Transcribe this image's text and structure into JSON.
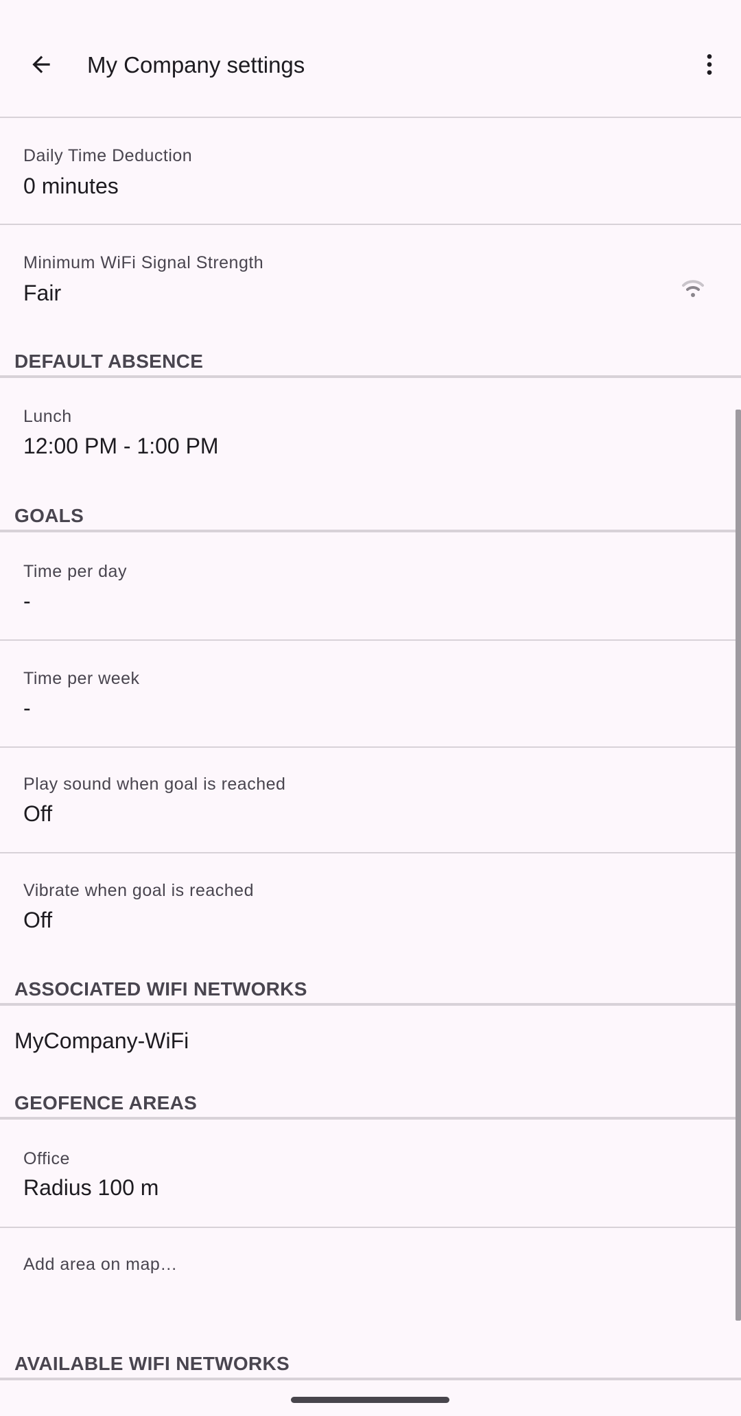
{
  "appbar": {
    "title": "My Company settings",
    "back_icon": "arrow-back-icon",
    "more_icon": "more-vert-icon"
  },
  "prefs": {
    "daily_time_deduction": {
      "title": "Daily Time Deduction",
      "summary": "0 minutes"
    },
    "min_wifi_strength": {
      "title": "Minimum WiFi Signal Strength",
      "summary": "Fair"
    }
  },
  "sections": {
    "default_absence": "DEFAULT ABSENCE",
    "goals": "GOALS",
    "associated_wifi": "ASSOCIATED WIFI NETWORKS",
    "geofence": "GEOFENCE AREAS",
    "available_wifi": "AVAILABLE WIFI NETWORKS"
  },
  "absence": {
    "title": "Lunch",
    "summary": "12:00 PM - 1:00 PM"
  },
  "goals": {
    "per_day": {
      "title": "Time per day",
      "summary": "-"
    },
    "per_week": {
      "title": "Time per week",
      "summary": "-"
    },
    "sound": {
      "title": "Play sound when goal is reached",
      "summary": "Off"
    },
    "vibrate": {
      "title": "Vibrate when goal is reached",
      "summary": "Off"
    }
  },
  "wifi_networks": [
    "MyCompany-WiFi"
  ],
  "geofence": {
    "office": {
      "title": "Office",
      "summary": "Radius 100 m"
    },
    "add_label": "Add area on map…"
  },
  "colors": {
    "background": "#FDF7FC",
    "divider": "#D8D2D8",
    "secondary_text": "#49454F"
  }
}
